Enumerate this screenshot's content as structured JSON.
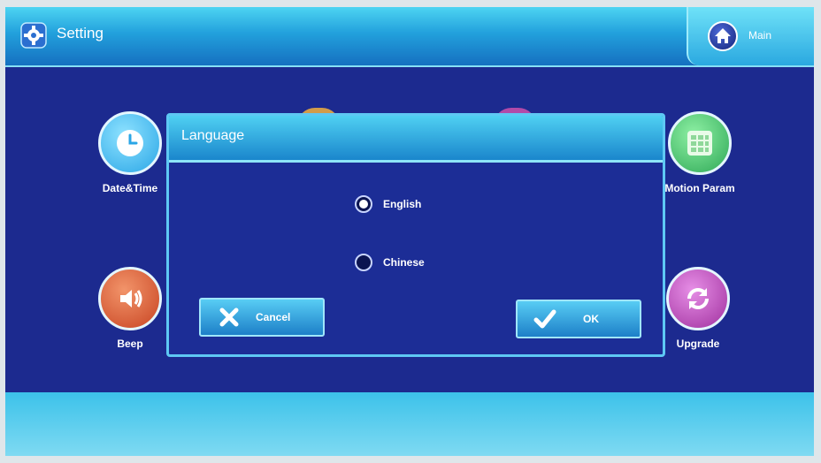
{
  "header": {
    "title": "Setting",
    "main_label": "Main"
  },
  "tiles": {
    "date_time": "Date&Time",
    "motion_param": "Motion Param",
    "beep": "Beep",
    "upgrade": "Upgrade"
  },
  "dialog": {
    "title": "Language",
    "options": [
      {
        "label": "English",
        "selected": true
      },
      {
        "label": "Chinese",
        "selected": false
      }
    ],
    "cancel_label": "Cancel",
    "ok_label": "OK"
  },
  "colors": {
    "background": "#1c2a8f",
    "header": "#22a0dc",
    "dialog": "#1c2d96",
    "date_time_tile": "#36b8ee",
    "motion_tile": "#3cbf66",
    "beep_tile": "#d8502c",
    "upgrade_tile": "#b63cb8"
  },
  "icons": {
    "header": "gear-icon",
    "main": "home-icon",
    "date_time": "clock-icon",
    "motion_param": "grid-icon",
    "beep": "speaker-icon",
    "upgrade": "refresh-icon",
    "cancel": "x-icon",
    "ok": "checkmark-icon"
  }
}
